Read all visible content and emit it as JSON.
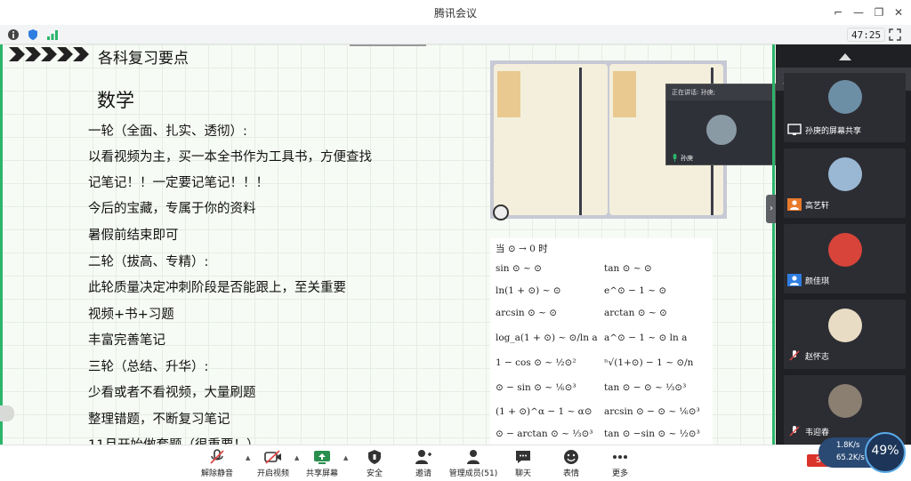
{
  "window": {
    "title": "腾讯会议"
  },
  "status": {
    "timer": "47:25"
  },
  "slide": {
    "heading": "各科复习要点",
    "subject": "数学",
    "lines": [
      "一轮（全面、扎实、透彻）:",
      "以看视频为主，买一本全书作为工具书，方便查找",
      "记笔记！！一定要记笔记！！！",
      "今后的宝藏，专属于你的资料",
      "暑假前结束即可",
      "二轮（拔高、专精）:",
      "此轮质量决定冲刺阶段是否能跟上，至关重要",
      "视频+书+习题",
      "丰富完善笔记",
      "三轮（总结、升华）:",
      "少看或者不看视频，大量刷题",
      "整理错题，不断复习笔记",
      "11月开始做套题（很重要！）"
    ],
    "formulas": [
      "当 ⊙ → 0 时",
      "sin ⊙ ~ ⊙",
      "tan ⊙ ~ ⊙",
      "ln(1 + ⊙) ~ ⊙",
      "e^⊙ − 1 ~ ⊙",
      "arcsin ⊙ ~ ⊙",
      "arctan ⊙ ~ ⊙",
      "log_a(1 + ⊙) ~ ⊙/ln a",
      "a^⊙ − 1 ~ ⊙ ln a",
      "1 − cos ⊙ ~ ½⊙²",
      "ⁿ√(1+⊙) − 1 ~ ⊙/n",
      "⊙ − sin ⊙ ~ ⅙⊙³",
      "tan ⊙ − ⊙ ~ ⅓⊙³",
      "(1 + ⊙)^α − 1 ~ α⊙",
      "arcsin ⊙ − ⊙ ~ ⅙⊙³",
      "⊙ − arctan ⊙ ~ ⅓⊙³",
      "tan ⊙ −sin ⊙ ~ ½⊙³"
    ],
    "mini_view": {
      "header": "正在讲话: 孙庚;",
      "name": "孙庚"
    }
  },
  "panel": {
    "speaking": "正在讲话: 孙庚;",
    "participants": [
      {
        "name": "孙庚的屏幕共享",
        "avatar_color": "#6d8fa6"
      },
      {
        "name": "高艺轩",
        "avatar_color": "#9ab8d3"
      },
      {
        "name": "颜佳琪",
        "avatar_color": "#d8443a"
      },
      {
        "name": "赵怀志",
        "avatar_color": "#e9dcc4"
      },
      {
        "name": "韦迎春",
        "avatar_color": "#8b7f72"
      }
    ]
  },
  "toolbar": {
    "unmute": "解除静音",
    "video": "开启视频",
    "share": "共享屏幕",
    "security": "安全",
    "invite": "邀请",
    "members": "管理成员(51)",
    "chat": "聊天",
    "reaction": "表情",
    "more": "更多"
  },
  "network": {
    "up": "1.8K/s",
    "down": "65.2K/s",
    "gauge": "49%"
  },
  "colors": {
    "accent": "#2bb56b",
    "panel_bg": "#1f2024"
  }
}
